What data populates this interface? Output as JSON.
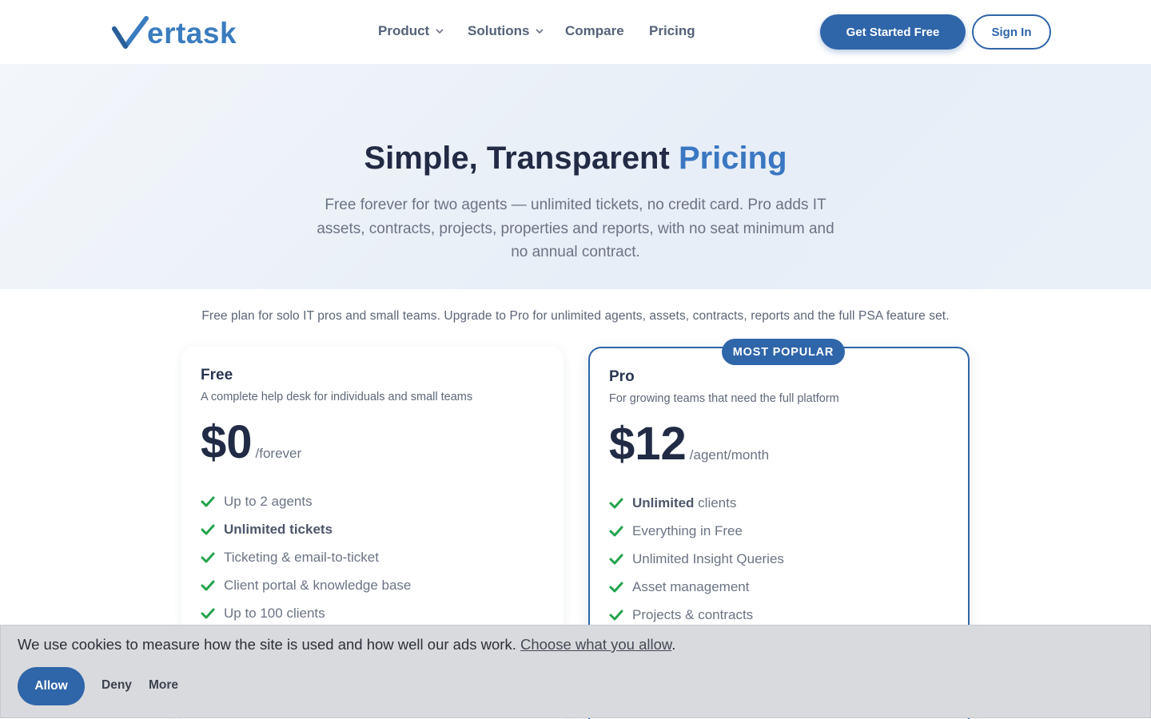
{
  "brand": {
    "name": "ertask",
    "accent": "#3a7cbf"
  },
  "nav": {
    "items": [
      {
        "label": "Product",
        "has_dropdown": true
      },
      {
        "label": "Solutions",
        "has_dropdown": true
      },
      {
        "label": "Compare",
        "has_dropdown": false
      },
      {
        "label": "Pricing",
        "has_dropdown": false
      }
    ],
    "cta_primary": "Get Started Free",
    "cta_secondary": "Sign In"
  },
  "hero": {
    "title_main": "Simple, Transparent ",
    "title_accent": "Pricing",
    "subtitle": "Free forever for two agents — unlimited tickets, no credit card. Pro adds IT assets, contracts, projects, properties and reports, with no seat minimum and no annual contract."
  },
  "intro": "Free plan for solo IT pros and small teams. Upgrade to Pro for unlimited agents, assets, contracts, reports and the full PSA feature set.",
  "plans": [
    {
      "name": "Free",
      "description": "A complete help desk for individuals and small teams",
      "price": "$0",
      "period": "/forever",
      "features": [
        {
          "bold": "",
          "text": "Up to 2 agents"
        },
        {
          "bold": "Unlimited tickets",
          "text": ""
        },
        {
          "bold": "",
          "text": "Ticketing & email-to-ticket"
        },
        {
          "bold": "",
          "text": "Client portal & knowledge base"
        },
        {
          "bold": "",
          "text": "Up to 100 clients"
        }
      ]
    },
    {
      "name": "Pro",
      "badge": "MOST POPULAR",
      "description": "For growing teams that need the full platform",
      "price": "$12",
      "period": "/agent/month",
      "features": [
        {
          "bold": "Unlimited",
          "text": " clients"
        },
        {
          "bold": "",
          "text": "Everything in Free"
        },
        {
          "bold": "",
          "text": "Unlimited Insight Queries"
        },
        {
          "bold": "",
          "text": "Asset management"
        },
        {
          "bold": "",
          "text": "Projects & contracts"
        }
      ]
    }
  ],
  "cookie": {
    "text": "We use cookies to measure how the site is used and how well our ads work. ",
    "link": "Choose what you allow",
    "suffix": ".",
    "allow": "Allow",
    "deny": "Deny",
    "more": "More"
  },
  "colors": {
    "primary": "#2f65a9",
    "check": "#22a34a",
    "hero_bg": "#eaf0f8"
  }
}
